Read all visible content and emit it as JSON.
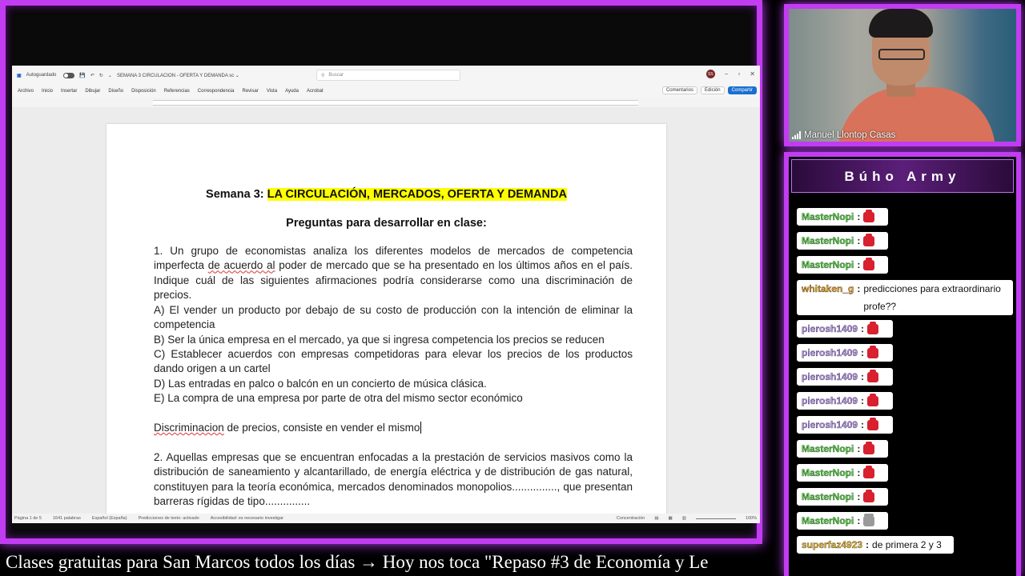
{
  "word": {
    "autosave_label": "Autoguardado",
    "doc_title": "SEMANA 3 CIRCULACION - OFERTA Y DEMANDA sc ⌄",
    "search_placeholder": "Buscar",
    "user_initials": "SS",
    "menu": [
      "Archivo",
      "Inicio",
      "Insertar",
      "Dibujar",
      "Diseño",
      "Disposición",
      "Referencias",
      "Correspondencia",
      "Revisar",
      "Vista",
      "Ayuda",
      "Acrobat"
    ],
    "comments_label": "Comentarios",
    "editing_label": "Edición",
    "share_label": "Compartir",
    "document": {
      "title_prefix": "Semana 3: ",
      "title_highlight": "LA CIRCULACIÓN, MERCADOS, OFERTA Y DEMANDA",
      "subtitle": "Preguntas para desarrollar en clase:",
      "q1_p1": "1. Un grupo de economistas analiza los diferentes modelos de mercados de competencia imperfecta ",
      "q1_p1_squiggle": "de acuerdo al",
      "q1_p1_rest": " poder de mercado que se ha presentado en los últimos años en el país. Indique cuál de las siguientes afirmaciones podría considerarse como una discriminación de precios.",
      "q1_a": "A) El vender un producto por debajo de su costo de producción con la intención de eliminar la competencia",
      "q1_b": "B) Ser la única empresa en el mercado, ya que si ingresa competencia los precios se reducen",
      "q1_c": "C) Establecer acuerdos con empresas competidoras para elevar los precios de los productos dando origen a un cartel",
      "q1_d": "D) Las entradas en palco o balcón en un concierto de música clásica.",
      "q1_e": "E) La compra de una empresa por parte de otra del mismo sector económico",
      "note_squiggle": "Discriminacion",
      "note_rest": " de precios, consiste en vender el mismo",
      "q2": "2. Aquellas empresas que se encuentran enfocadas a la prestación de servicios masivos como la distribución de saneamiento y alcantarillado, de energía eléctrica y de distribución de gas natural, constituyen para la teoría económica, mercados denominados monopolios..............., que presentan barreras rígidas de tipo..............."
    },
    "status": {
      "page": "Página 1 de 5",
      "words": "1641 palabras",
      "language": "Español (España)",
      "predictions": "Predicciones de texto: activado",
      "accessibility": "Accesibilidad: es necesario investigar",
      "focus": "Concentración",
      "zoom": "100%"
    }
  },
  "webcam": {
    "name": "Manuel Llontop Casas"
  },
  "chat": {
    "title": "Búho Army",
    "messages": [
      {
        "user": "MasterNopi",
        "text": "",
        "emote": "red",
        "color": "green"
      },
      {
        "user": "MasterNopi",
        "text": "",
        "emote": "red",
        "color": "green"
      },
      {
        "user": "MasterNopi",
        "text": "",
        "emote": "red",
        "color": "green"
      },
      {
        "user": "whitaken_g",
        "text": "predicciones para extraordinario profe??",
        "emote": "",
        "color": "orange"
      },
      {
        "user": "pierosh1409",
        "text": "",
        "emote": "red",
        "color": "purple"
      },
      {
        "user": "pierosh1409",
        "text": "",
        "emote": "red",
        "color": "purple"
      },
      {
        "user": "pierosh1409",
        "text": "",
        "emote": "red",
        "color": "purple"
      },
      {
        "user": "pierosh1409",
        "text": "",
        "emote": "red",
        "color": "purple"
      },
      {
        "user": "pierosh1409",
        "text": "",
        "emote": "red",
        "color": "purple"
      },
      {
        "user": "MasterNopi",
        "text": "",
        "emote": "red",
        "color": "green"
      },
      {
        "user": "MasterNopi",
        "text": "",
        "emote": "red",
        "color": "green"
      },
      {
        "user": "MasterNopi",
        "text": "",
        "emote": "red",
        "color": "green"
      },
      {
        "user": "MasterNopi",
        "text": "",
        "emote": "cat",
        "color": "green"
      },
      {
        "user": "superfaz4923",
        "text": "de primera 2 y 3",
        "emote": "",
        "color": "gold"
      }
    ]
  },
  "ticker": "Clases gratuitas para San Marcos todos los días  →  Hoy nos toca \"Repaso #3 de Economía y Le",
  "colors": {
    "frame": "#c23cf2",
    "highlight": "#ffff00",
    "share": "#1a6fd1"
  }
}
